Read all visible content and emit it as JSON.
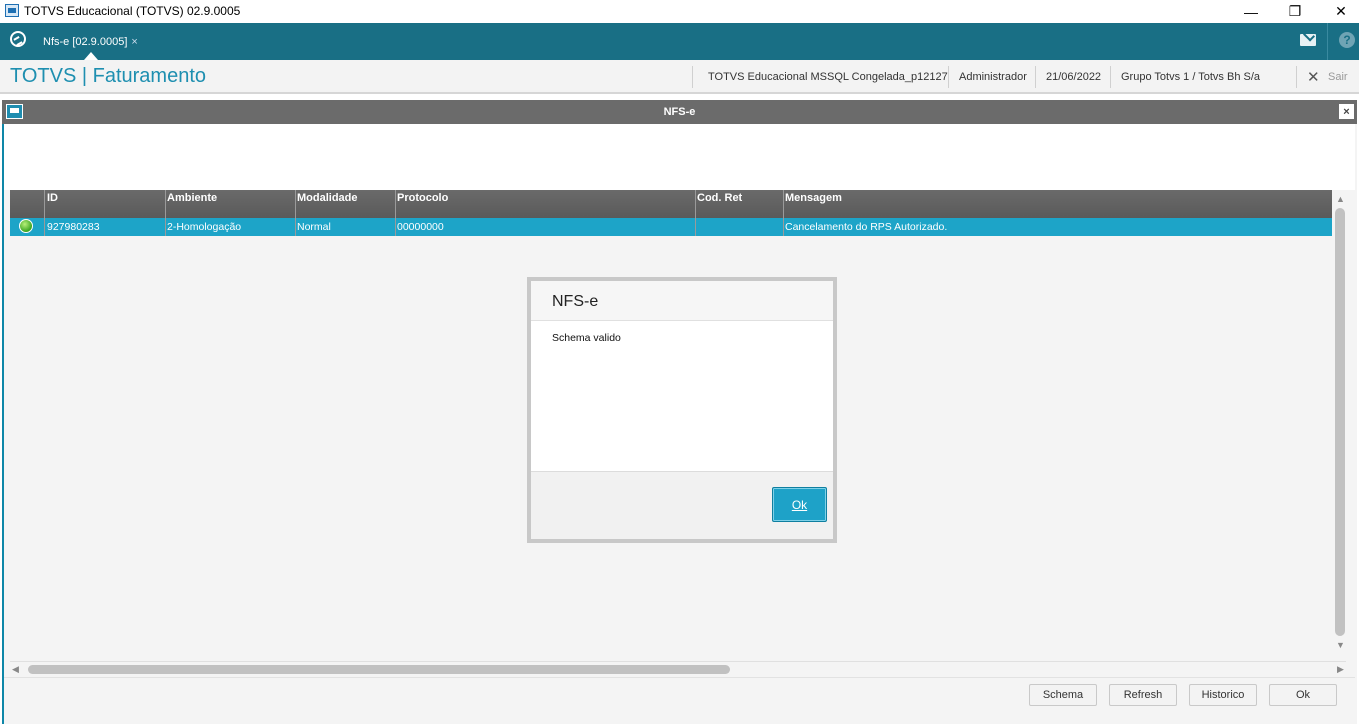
{
  "window": {
    "title": "TOTVS Educacional (TOTVS) 02.9.0005",
    "controls": {
      "minimize": "—",
      "restore": "❐",
      "close": "✕"
    }
  },
  "tabbar": {
    "tab_label": "Nfs-e [02.9.0005]",
    "tab_close": "×",
    "help": "?",
    "color": "#196f85"
  },
  "header": {
    "module_title": "TOTVS | Faturamento",
    "environment": "TOTVS Educacional MSSQL Congelada_p12127",
    "user": "Administrador",
    "date": "21/06/2022",
    "company": "Grupo Totvs 1 / Totvs  Bh S/a",
    "exit_icon": "✕",
    "exit_label": "Sair",
    "accent": "#1e8fb0"
  },
  "dialog_window": {
    "title": "NFS-e",
    "close": "×"
  },
  "grid": {
    "columns": [
      "ID",
      "Ambiente",
      "Modalidade",
      "Protocolo",
      "Cod. Ret",
      "Mensagem"
    ],
    "rows": [
      {
        "status": "green-ok",
        "id": "927980283",
        "ambiente": "2-Homologação",
        "modalidade": "Normal",
        "protocolo": "00000000",
        "cod_ret": "",
        "mensagem": "Cancelamento do RPS Autorizado."
      }
    ],
    "selected_color": "#1da4c8"
  },
  "scroll": {
    "up": "▲",
    "down": "▼",
    "left": "◀",
    "right": "▶"
  },
  "footer": {
    "schema": "Schema",
    "refresh": "Refresh",
    "historico": "Historico",
    "ok": "Ok"
  },
  "modal": {
    "title": "NFS-e",
    "message": "Schema valido",
    "ok": "Ok"
  }
}
